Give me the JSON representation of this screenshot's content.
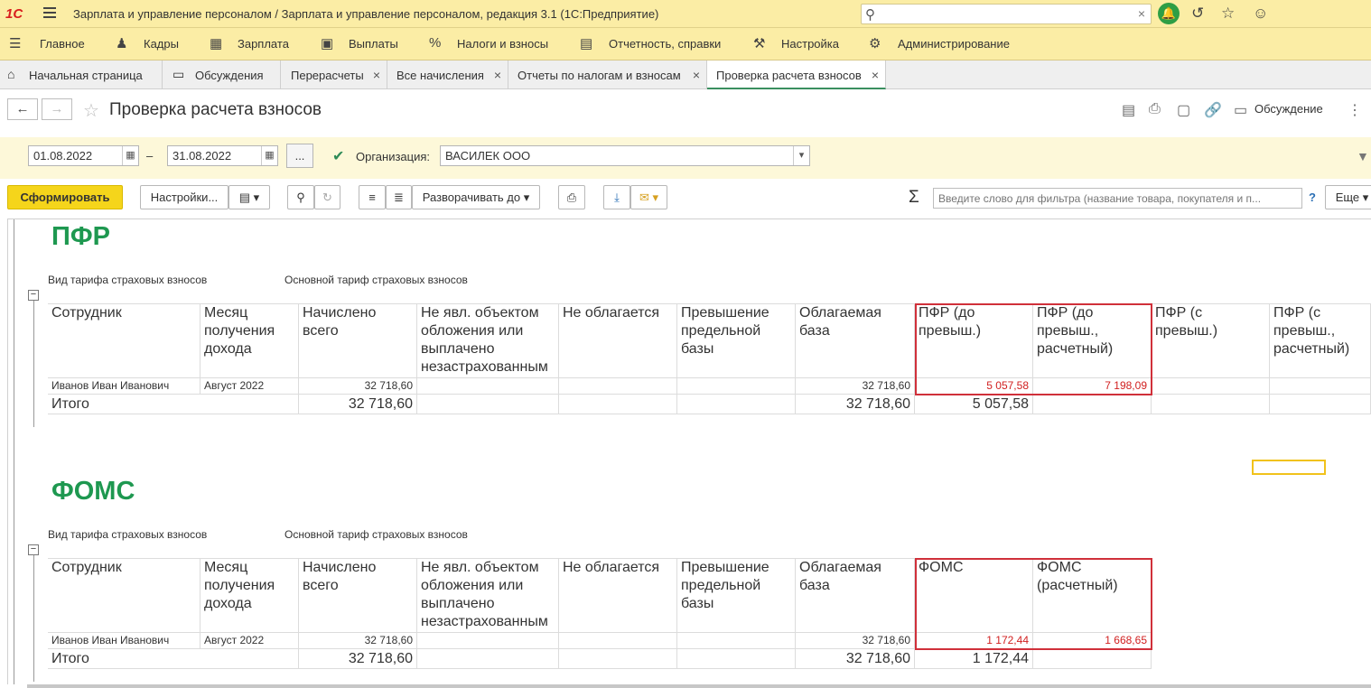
{
  "titlebar": {
    "logo": "1С",
    "title": "Зарплата и управление персоналом / Зарплата и управление персоналом, редакция 3.1  (1С:Предприятие)"
  },
  "menu": [
    "Главное",
    "Кадры",
    "Зарплата",
    "Выплаты",
    "Налоги и взносы",
    "Отчетность, справки",
    "Настройка",
    "Администрирование"
  ],
  "tabs": [
    "Начальная страница",
    "Обсуждения",
    "Перерасчеты",
    "Все начисления",
    "Отчеты по налогам и взносам",
    "Проверка расчета взносов"
  ],
  "page": {
    "title": "Проверка расчета взносов",
    "discuss": "Обсуждение"
  },
  "params": {
    "date_from": "01.08.2022",
    "dash": "–",
    "date_to": "31.08.2022",
    "dots": "...",
    "org_label": "Организация:",
    "org_value": "ВАСИЛЕК ООО"
  },
  "toolbar": {
    "generate": "Сформировать",
    "settings": "Настройки...",
    "expand": "Разворачивать до",
    "filter_placeholder": "Введите слово для фильтра (название товара, покупателя и п...",
    "help": "?",
    "more": "Еще"
  },
  "report": {
    "tariff_label": "Вид тарифа страховых взносов",
    "tariff_value": "Основной тариф страховых взносов",
    "pfr": {
      "title": "ПФР",
      "headers": [
        "Сотрудник",
        "Месяц получения дохода",
        "Начислено всего",
        "Не явл. объектом обложения или выплачено незастрахованным",
        "Не облагается",
        "Превышение предельной базы",
        "Облагаемая база",
        "ПФР (до превыш.)",
        "ПФР (до превыш., расчетный)",
        "ПФР (с превыш.)",
        "ПФР (с превыш., расчетный)"
      ],
      "row": {
        "employee": "Иванов Иван Иванович",
        "month": "Август 2022",
        "accrued": "32 718,60",
        "base": "32 718,60",
        "pfr": "5 057,58",
        "pfr_calc": "7 198,09"
      },
      "total": {
        "label": "Итого",
        "accrued": "32 718,60",
        "base": "32 718,60",
        "pfr": "5 057,58"
      }
    },
    "foms": {
      "title": "ФОМС",
      "headers": [
        "Сотрудник",
        "Месяц получения дохода",
        "Начислено всего",
        "Не явл. объектом обложения или выплачено незастрахованным",
        "Не облагается",
        "Превышение предельной базы",
        "Облагаемая база",
        "ФОМС",
        "ФОМС (расчетный)"
      ],
      "row": {
        "employee": "Иванов Иван Иванович",
        "month": "Август 2022",
        "accrued": "32 718,60",
        "base": "32 718,60",
        "foms": "1 172,44",
        "foms_calc": "1 668,65"
      },
      "total": {
        "label": "Итого",
        "accrued": "32 718,60",
        "base": "32 718,60",
        "foms": "1 172,44"
      }
    }
  },
  "colors": {
    "accent": "#fbeda5",
    "generate": "#f5d51b",
    "section": "#1e9850",
    "highlight": "#d0303a"
  }
}
